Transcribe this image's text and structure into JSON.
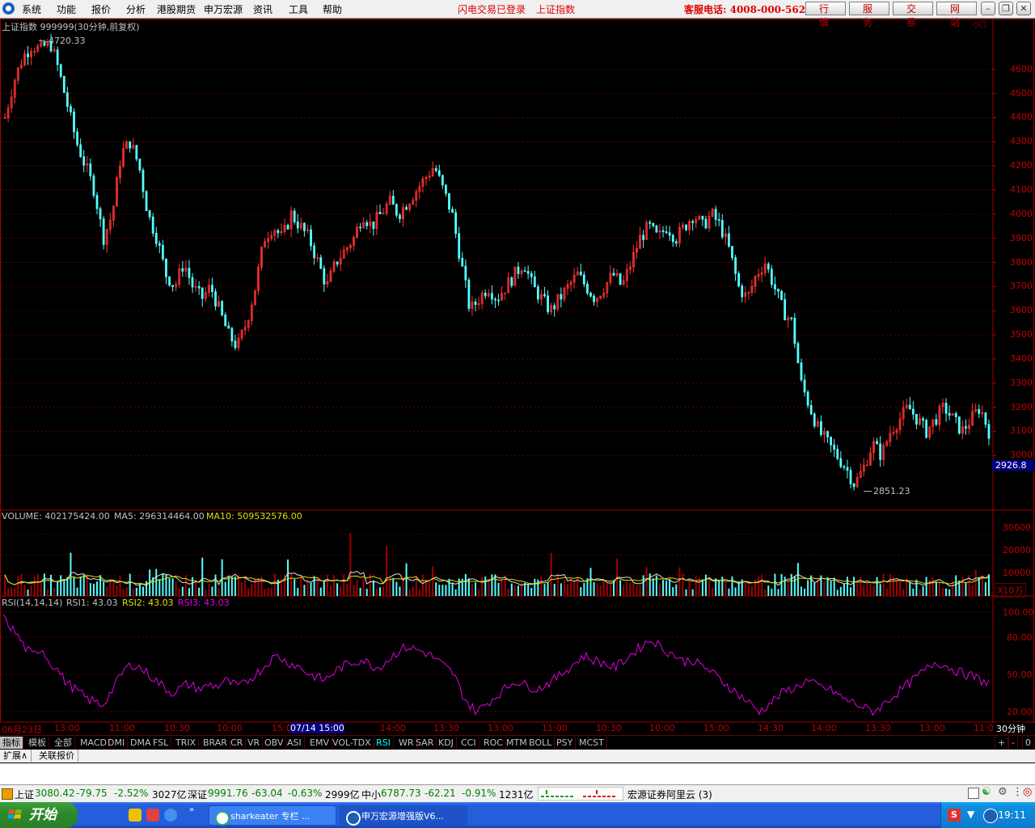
{
  "menu": {
    "items": [
      "系统",
      "功能",
      "报价",
      "分析",
      "港股期货",
      "申万宏源",
      "资讯",
      "工具",
      "帮助"
    ],
    "notice_login": "闪电交易已登录",
    "notice_index": "上证指数",
    "hotline": "客服电话: 4008-000-562",
    "buttons": [
      "行 情",
      "服 务",
      "交 易",
      "网 站"
    ]
  },
  "main_chart": {
    "title": "上证指数 999999(30分钟,前复权)",
    "high_label": "4720.33",
    "low_label": "2851.23",
    "current_price_label": "2926.8",
    "y_ticks": [
      "4600",
      "4500",
      "4400",
      "4300",
      "4200",
      "4100",
      "4000",
      "3900",
      "3800",
      "3700",
      "3600",
      "3500",
      "3400",
      "3300",
      "3200",
      "3100",
      "3000"
    ]
  },
  "volume_panel": {
    "label": "VOLUME: 402175424.00",
    "ma5": "MA5: 296314464.00",
    "ma10": "MA10: 509532576.00",
    "y_ticks": [
      "30000",
      "20000",
      "10000"
    ],
    "unit": "X10万"
  },
  "rsi_panel": {
    "label": "RSI(14,14,14)",
    "rsi1": "RSI1: 43.03",
    "rsi2": "RSI2: 43.03",
    "rsi3": "RSI3: 43.03",
    "y_ticks": [
      "100.00",
      "80.00",
      "50.00",
      "20.00"
    ]
  },
  "time_axis": {
    "labels": [
      "06月23日",
      "13:00",
      "11:00",
      "10:30",
      "10:00",
      "15:00",
      "07/14 15:00",
      "14:00",
      "13:30",
      "13:00",
      "11:00",
      "10:30",
      "10:00",
      "15:00",
      "14:30",
      "14:00",
      "13:30",
      "13:00",
      "11:0"
    ],
    "period": "30分钟"
  },
  "indicator_tabs": [
    "指标",
    "模板",
    "全部",
    "MACD",
    "DMI",
    "DMA",
    "FSL",
    "TRIX",
    "BRAR",
    "CR",
    "VR",
    "OBV",
    "ASI",
    "EMV",
    "VOL-TDX",
    "RSI",
    "WR",
    "SAR",
    "KDJ",
    "CCI",
    "ROC",
    "MTM",
    "BOLL",
    "PSY",
    "MCST"
  ],
  "active_tab": "RSI",
  "tab_controls": [
    "+",
    "-",
    "0"
  ],
  "ext_tabs": [
    "扩展∧",
    "关联报价"
  ],
  "status": {
    "sh_name": "上证",
    "sh_price": "3080.42",
    "sh_change": "-79.75",
    "sh_pct": "-2.52%",
    "sh_amount": "3027亿",
    "sz_name": "深证",
    "sz_price": "9991.76",
    "sz_change": "-63.04",
    "sz_pct": "-0.63%",
    "sz_amount": "2999亿",
    "zx_name": "中小",
    "zx_price": "6787.73",
    "zx_change": "-62.21",
    "zx_pct": "-0.91%",
    "zx_amount": "1231亿",
    "broker": "宏源证券阿里云 (3)"
  },
  "taskbar": {
    "start": "开始",
    "tasks": [
      "sharkeater 专栏 ...",
      "申万宏源增强版V6..."
    ],
    "clock": "19:11"
  },
  "chart_data": {
    "type": "candlestick",
    "title": "上证指数 999999(30分钟,前复权)",
    "y_range": [
      2850,
      4720
    ],
    "high": 4720.33,
    "low": 2851.23,
    "last": 2926.8,
    "close_path": [
      4400,
      4550,
      4650,
      4700,
      4680,
      4720,
      4600,
      4450,
      4300,
      4200,
      4100,
      3900,
      4000,
      4250,
      4300,
      4200,
      4000,
      3900,
      3750,
      3700,
      3800,
      3700,
      3650,
      3700,
      3600,
      3500,
      3450,
      3550,
      3700,
      3900,
      3950,
      3900,
      4000,
      3950,
      3900,
      3800,
      3700,
      3800,
      3850,
      3900,
      4000,
      3950,
      4000,
      4050,
      4000,
      4050,
      4100,
      4150,
      4200,
      4100,
      4000,
      3800,
      3600,
      3650,
      3700,
      3650,
      3700,
      3750,
      3800,
      3700,
      3650,
      3600,
      3650,
      3700,
      3750,
      3700,
      3650,
      3700,
      3750,
      3700,
      3800,
      3900,
      3950,
      3900,
      3950,
      3900,
      3950,
      4000,
      3950,
      4000,
      3950,
      3850,
      3700,
      3650,
      3750,
      3800,
      3700,
      3600,
      3550,
      3300,
      3200,
      3100,
      3050,
      3000,
      2950,
      2880,
      2950,
      3050,
      3000,
      3100,
      3150,
      3200,
      3150,
      3100,
      3150,
      3200,
      3150,
      3100,
      3150,
      3200,
      3100
    ],
    "volume_y_range": [
      0,
      35000
    ],
    "rsi_y_range": [
      0,
      100
    ],
    "rsi_path": [
      95,
      88,
      80,
      70,
      65,
      72,
      60,
      55,
      45,
      40,
      35,
      30,
      28,
      25,
      35,
      45,
      55,
      58,
      55,
      50,
      45,
      40,
      35,
      38,
      42,
      40,
      38,
      42,
      40,
      45,
      42,
      40,
      45,
      50,
      55,
      62,
      65,
      60,
      58,
      55,
      50,
      48,
      45,
      50,
      55,
      58,
      60,
      62,
      58,
      55,
      60,
      65,
      70,
      72,
      70,
      68,
      65,
      60,
      55,
      50,
      35,
      25,
      20,
      25,
      30,
      35,
      40,
      45,
      42,
      40,
      38,
      42,
      45,
      50,
      55,
      60,
      65,
      62,
      60,
      58,
      55,
      60,
      65,
      70,
      75,
      78,
      72,
      68,
      65,
      60,
      62,
      58,
      55,
      50,
      45,
      40,
      35,
      30,
      25,
      20,
      25,
      30,
      35,
      38,
      40,
      45,
      42,
      40,
      38,
      35,
      30,
      28,
      25,
      22,
      20,
      25,
      30,
      35,
      40,
      45,
      50,
      55,
      60,
      58,
      55,
      52,
      50,
      48,
      45,
      43
    ]
  }
}
